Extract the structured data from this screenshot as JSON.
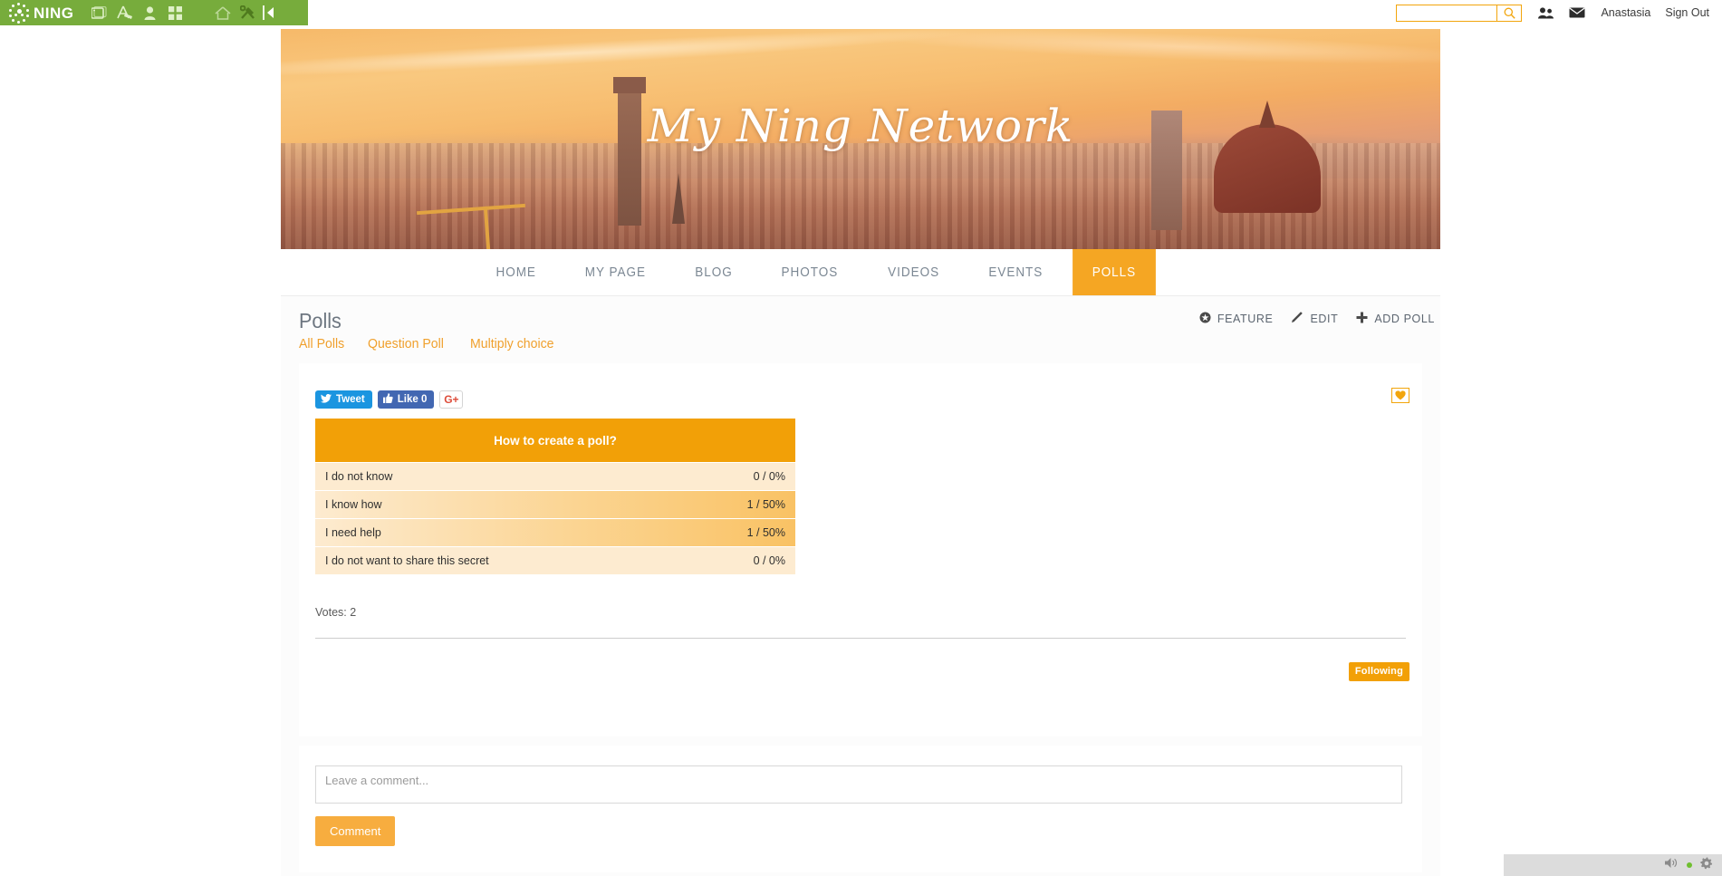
{
  "admin_bar": {
    "brand": "NING",
    "icons": [
      {
        "name": "windows-icon",
        "label": "Site"
      },
      {
        "name": "design-icon",
        "label": "Design"
      },
      {
        "name": "person-icon",
        "label": "Members"
      },
      {
        "name": "grid-icon",
        "label": "Apps"
      },
      {
        "name": "home-icon",
        "label": "Home"
      },
      {
        "name": "tools-icon",
        "label": "Tools"
      }
    ],
    "collapse_icon": "collapse-arrow-icon",
    "search": {
      "value": "",
      "placeholder": "",
      "icon": "search-icon"
    },
    "people_icon": "people-icon",
    "messages_icon": "envelope-icon",
    "user_name": "Anastasia",
    "sign_out": "Sign Out"
  },
  "banner": {
    "title": "My Ning Network"
  },
  "nav": {
    "items": [
      {
        "label": "HOME",
        "active": false
      },
      {
        "label": "MY PAGE",
        "active": false
      },
      {
        "label": "BLOG",
        "active": false
      },
      {
        "label": "PHOTOS",
        "active": false
      },
      {
        "label": "VIDEOS",
        "active": false
      },
      {
        "label": "EVENTS",
        "active": false
      },
      {
        "label": "POLLS",
        "active": true
      }
    ]
  },
  "page": {
    "title": "Polls",
    "actions": [
      {
        "label": "FEATURE",
        "icon": "feature-star-icon"
      },
      {
        "label": "EDIT",
        "icon": "pencil-icon"
      },
      {
        "label": "ADD POLL",
        "icon": "plus-icon"
      }
    ],
    "filters": [
      {
        "label": "All Polls",
        "active": true
      },
      {
        "label": "Question Poll",
        "active": false
      },
      {
        "label": "Multiply choice",
        "active": false
      }
    ]
  },
  "share": {
    "tweet_label": "Tweet",
    "tweet_icon": "twitter-bird-icon",
    "like_label": "Like 0",
    "like_icon": "facebook-thumb-icon",
    "gplus_label": "G+",
    "favorite_icon": "heart-icon"
  },
  "poll": {
    "question": "How to create a poll?",
    "options": [
      {
        "label": "I do not know",
        "votes": 0,
        "percent": 0,
        "value_text": "0 / 0%"
      },
      {
        "label": "I know how",
        "votes": 1,
        "percent": 50,
        "value_text": "1 / 50%"
      },
      {
        "label": "I need help",
        "votes": 1,
        "percent": 50,
        "value_text": "1 / 50%"
      },
      {
        "label": "I do not want to share this secret",
        "votes": 0,
        "percent": 0,
        "value_text": "0 / 0%"
      }
    ],
    "votes_label": "Votes: 2",
    "total_votes": 2
  },
  "follow": {
    "button_label": "Following"
  },
  "comment": {
    "placeholder": "Leave a comment...",
    "value": "",
    "button_label": "Comment"
  },
  "corner_widget": {
    "speaker_icon": "speaker-icon",
    "status_icon": "green-dot-icon",
    "settings_icon": "gear-icon"
  },
  "colors": {
    "ning_green": "#77ac3c",
    "accent_orange": "#f5a623",
    "poll_header": "#f2a007",
    "poll_row_bg": "#fdebd0",
    "poll_bar_end": "#f9c264",
    "link_orange": "#f0a02c",
    "twitter_blue": "#1b95e0",
    "facebook_blue": "#4267b2",
    "gplus_red": "#dd4b39"
  }
}
